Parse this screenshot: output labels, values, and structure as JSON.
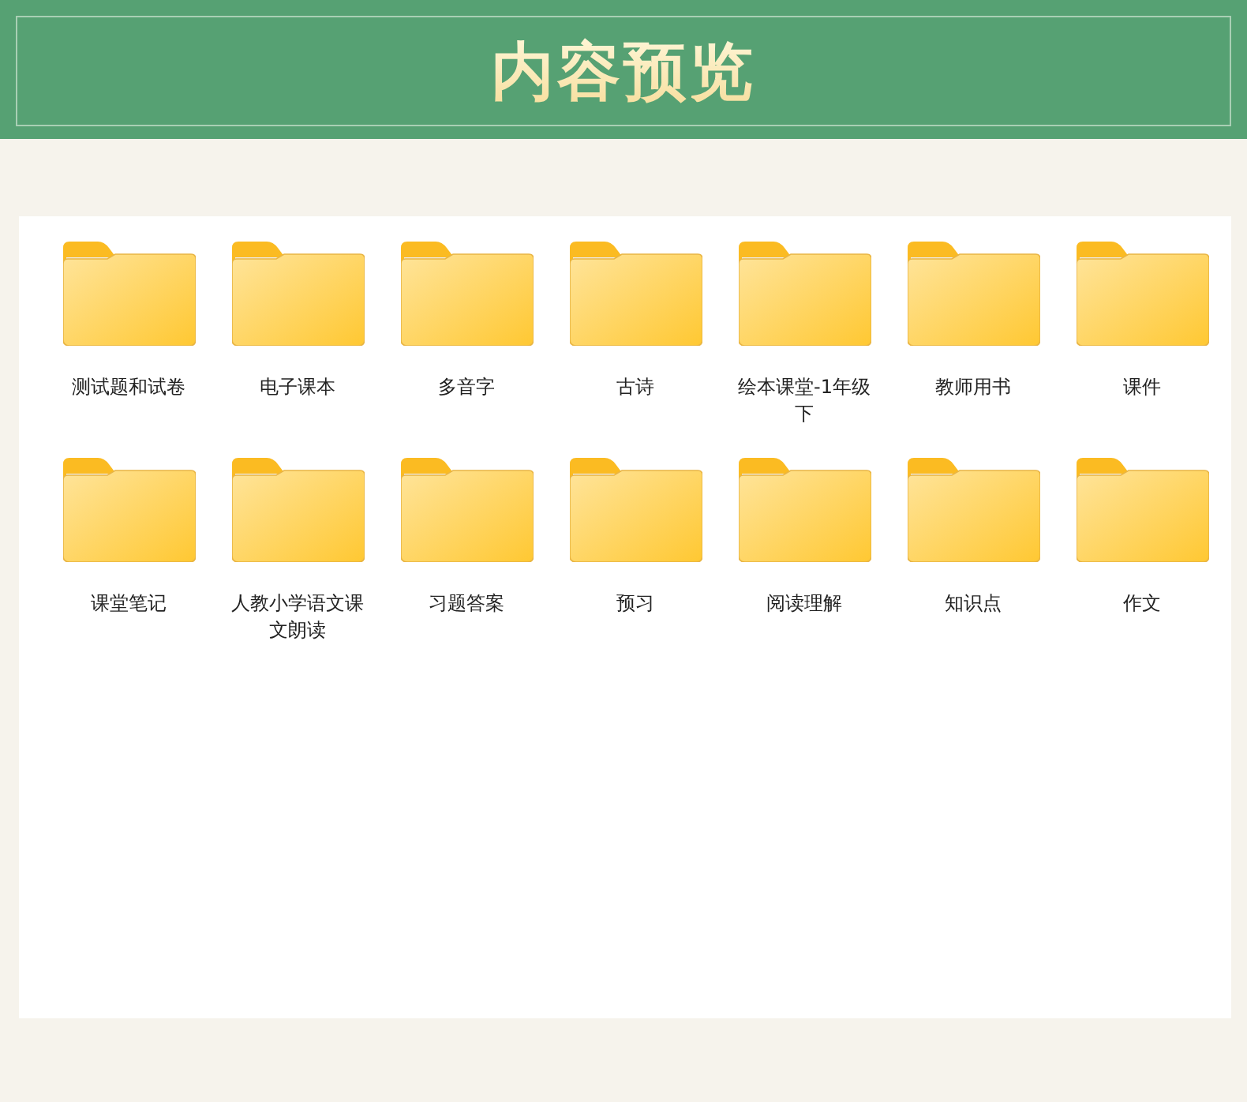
{
  "header": {
    "title": "内容预览"
  },
  "folders": [
    {
      "name": "测试题和试卷"
    },
    {
      "name": "电子课本"
    },
    {
      "name": "多音字"
    },
    {
      "name": "古诗"
    },
    {
      "name": "绘本课堂-1年级下"
    },
    {
      "name": "教师用书"
    },
    {
      "name": "课件"
    },
    {
      "name": "课堂笔记"
    },
    {
      "name": "人教小学语文课文朗读"
    },
    {
      "name": "习题答案"
    },
    {
      "name": "预习"
    },
    {
      "name": "阅读理解"
    },
    {
      "name": "知识点"
    },
    {
      "name": "作文"
    }
  ]
}
